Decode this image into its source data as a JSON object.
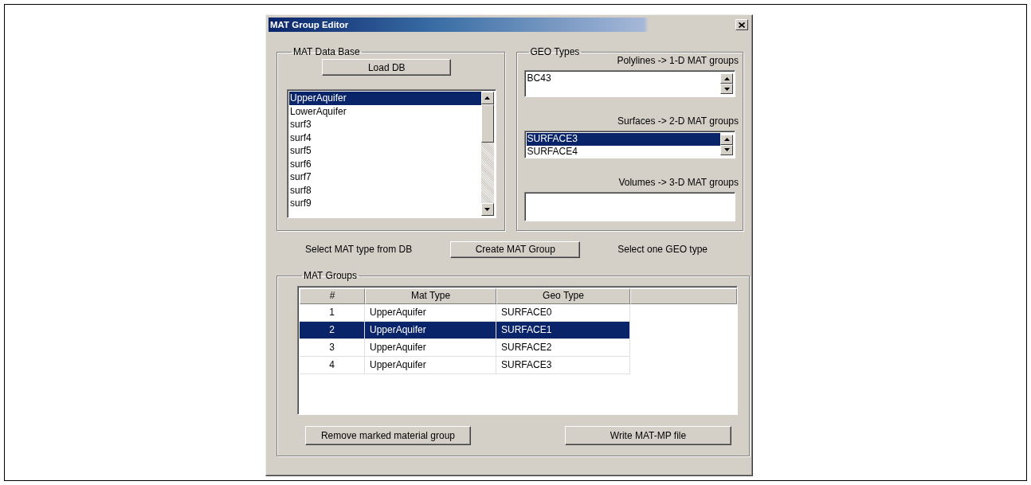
{
  "window": {
    "title": "MAT Group Editor"
  },
  "mat_database": {
    "title": "MAT Data Base",
    "load_button": "Load DB",
    "items": [
      {
        "label": "UpperAquifer",
        "selected": true
      },
      {
        "label": "LowerAquifer",
        "selected": false
      },
      {
        "label": "surf3",
        "selected": false
      },
      {
        "label": "surf4",
        "selected": false
      },
      {
        "label": "surf5",
        "selected": false
      },
      {
        "label": "surf6",
        "selected": false
      },
      {
        "label": "surf7",
        "selected": false
      },
      {
        "label": "surf8",
        "selected": false
      },
      {
        "label": "surf9",
        "selected": false
      }
    ]
  },
  "geo_types": {
    "title": "GEO Types",
    "sections": [
      {
        "label": "Polylines -> 1-D MAT groups",
        "items": [
          {
            "label": "BC43",
            "selected": false
          }
        ]
      },
      {
        "label": "Surfaces -> 2-D MAT groups",
        "items": [
          {
            "label": "SURFACE3",
            "selected": true
          },
          {
            "label": "SURFACE4",
            "selected": false
          }
        ]
      },
      {
        "label": "Volumes -> 3-D MAT groups"
      }
    ]
  },
  "create_row": {
    "left_hint": "Select MAT type from DB",
    "button": "Create MAT Group",
    "right_hint": "Select one GEO type"
  },
  "mat_groups": {
    "title": "MAT Groups",
    "columns": [
      "#",
      "Mat Type",
      "Geo Type"
    ],
    "rows": [
      {
        "cells": [
          "1",
          "UpperAquifer",
          "SURFACE0"
        ],
        "selected": false
      },
      {
        "cells": [
          "2",
          "UpperAquifer",
          "SURFACE1"
        ],
        "selected": true
      },
      {
        "cells": [
          "3",
          "UpperAquifer",
          "SURFACE2"
        ],
        "selected": false
      },
      {
        "cells": [
          "4",
          "UpperAquifer",
          "SURFACE3"
        ],
        "selected": false
      }
    ]
  },
  "buttons": [
    "Remove marked material group",
    "Write MAT-MP file"
  ]
}
